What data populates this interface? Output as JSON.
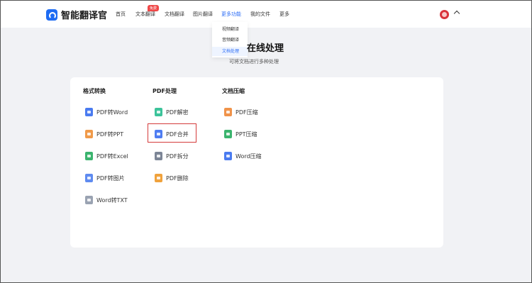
{
  "app": {
    "title": "智能翻译官"
  },
  "nav": {
    "items": [
      {
        "id": "home",
        "label": "首页"
      },
      {
        "id": "text",
        "label": "文本翻译",
        "badge": "免费"
      },
      {
        "id": "doc",
        "label": "文档翻译"
      },
      {
        "id": "image",
        "label": "图片翻译"
      },
      {
        "id": "more-functions",
        "label": "更多功能",
        "active": true
      },
      {
        "id": "my-files",
        "label": "我的文件"
      },
      {
        "id": "more",
        "label": "更多"
      }
    ]
  },
  "dropdown": {
    "items": [
      {
        "label": "视频翻译"
      },
      {
        "label": "音频翻译"
      },
      {
        "label": "文档处理",
        "active": true
      }
    ]
  },
  "page": {
    "title": "在线处理",
    "subtitle": "可将文档进行多种处理"
  },
  "columns": [
    {
      "title": "格式转换",
      "tools": [
        {
          "label": "PDF转Word",
          "icon": "word-file-icon",
          "color": "#4a7bf0"
        },
        {
          "label": "PDF转PPT",
          "icon": "ppt-file-icon",
          "color": "#f09a4a"
        },
        {
          "label": "PDF转Excel",
          "icon": "excel-file-icon",
          "color": "#3bb46e"
        },
        {
          "label": "PDF转图片",
          "icon": "image-file-icon",
          "color": "#5f8bf0"
        },
        {
          "label": "Word转TXT",
          "icon": "txt-file-icon",
          "color": "#9aa3b2"
        }
      ]
    },
    {
      "title": "PDF处理",
      "tools": [
        {
          "label": "PDF解密",
          "icon": "unlock-file-icon",
          "color": "#3cc39a"
        },
        {
          "label": "PDF合并",
          "icon": "merge-file-icon",
          "color": "#4f7df2",
          "highlighted": true
        },
        {
          "label": "PDF拆分",
          "icon": "split-file-icon",
          "color": "#7c8596"
        },
        {
          "label": "PDF删除",
          "icon": "delete-file-icon",
          "color": "#f0a23c"
        }
      ]
    },
    {
      "title": "文档压缩",
      "tools": [
        {
          "label": "PDF压缩",
          "icon": "pdf-compress-icon",
          "color": "#f0934a"
        },
        {
          "label": "PPT压缩",
          "icon": "ppt-compress-icon",
          "color": "#3bb46e"
        },
        {
          "label": "Word压缩",
          "icon": "word-compress-icon",
          "color": "#4a7bf0"
        }
      ]
    }
  ],
  "colors": {
    "accent": "#2b6cf6",
    "highlight_border": "#d43b3b"
  }
}
